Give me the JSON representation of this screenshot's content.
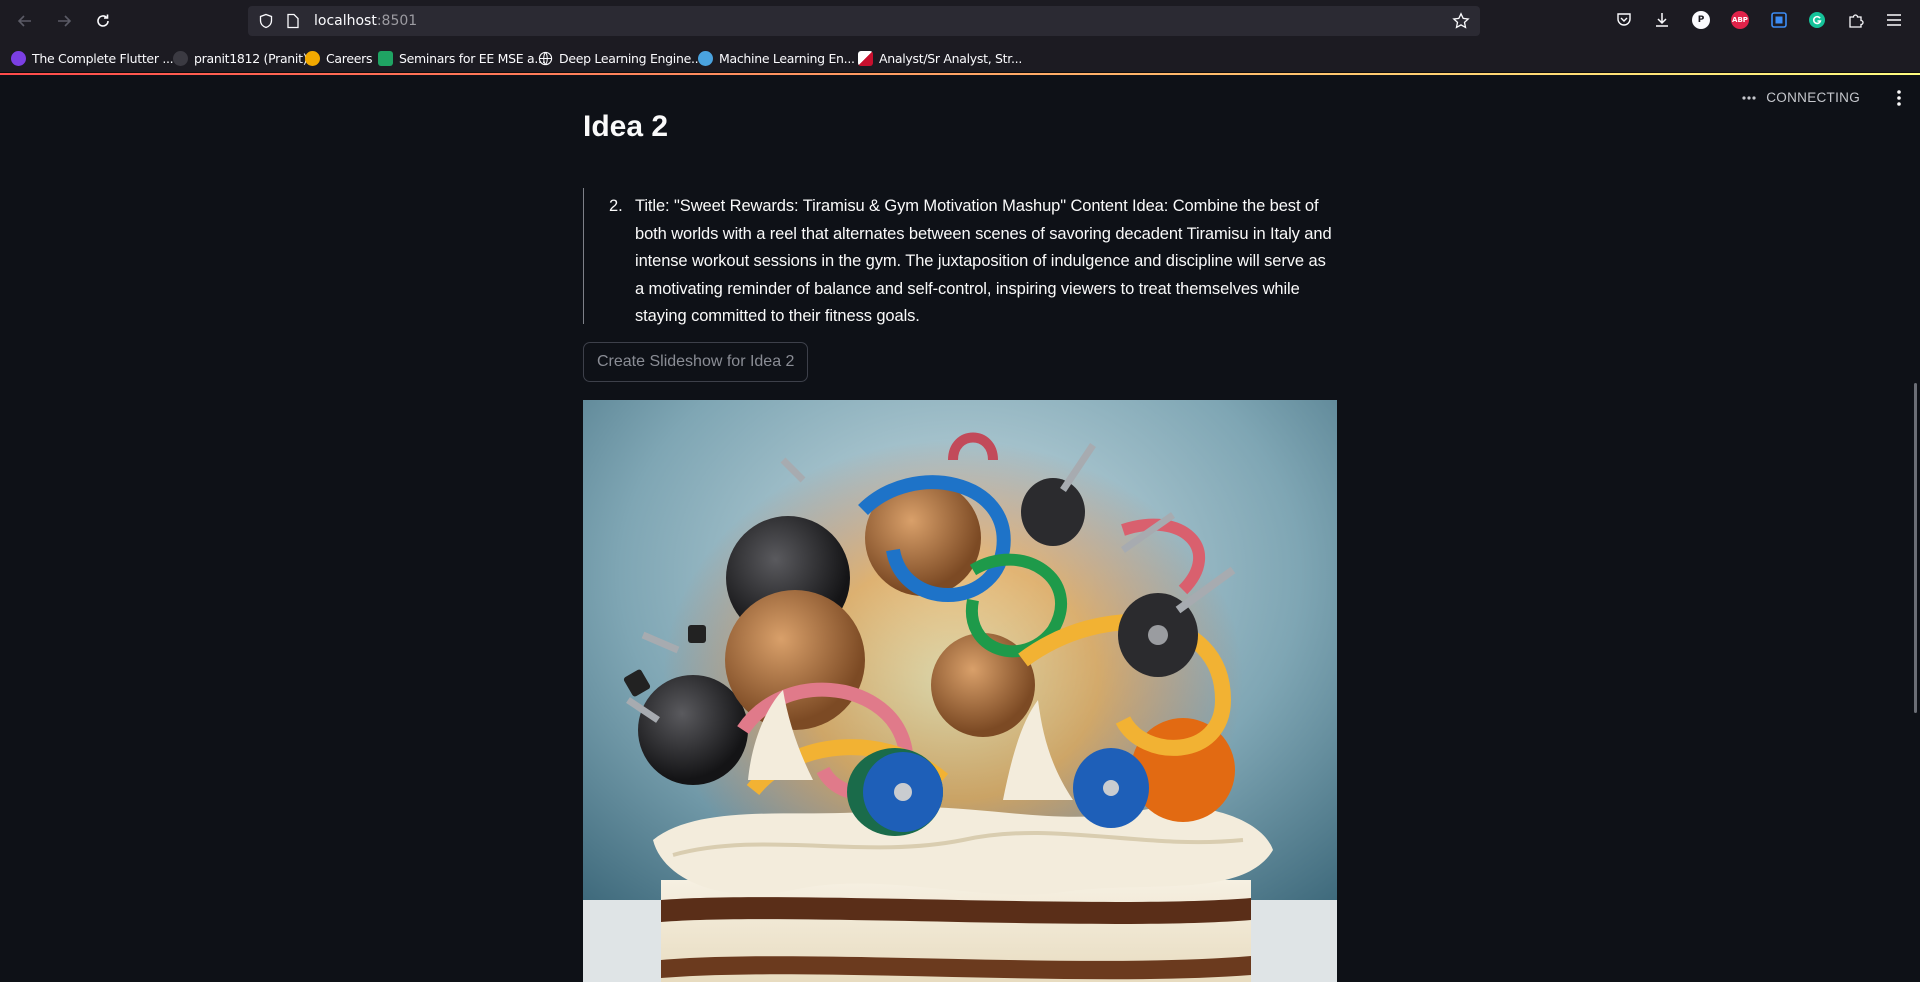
{
  "browser": {
    "url_host": "localhost",
    "url_port": ":8501",
    "bookmarks": [
      {
        "label": "The Complete Flutter ...",
        "color": "#7b3fe4"
      },
      {
        "label": "pranit1812 (Pranit)",
        "color": "#2b2a33"
      },
      {
        "label": "Careers",
        "color": "#f2a900"
      },
      {
        "label": "Seminars for EE MSE a...",
        "color": "#1fa463"
      },
      {
        "label": "Deep Learning Engine...",
        "color": "#1c1b22"
      },
      {
        "label": "Machine Learning En...",
        "color": "#4aa3df"
      },
      {
        "label": "Analyst/Sr Analyst, Str...",
        "color": "#ffffff"
      }
    ],
    "extensions": {
      "p_label": "P",
      "abp_label": "ABP"
    }
  },
  "app": {
    "status": "CONNECTING"
  },
  "idea": {
    "heading": "Idea 2",
    "number": "2.",
    "text": "Title: \"Sweet Rewards: Tiramisu & Gym Motivation Mashup\" Content Idea: Combine the best of both worlds with a reel that alternates between scenes of savoring decadent Tiramisu in Italy and intense workout sessions in the gym. The juxtaposition of indulgence and discipline will serve as a motivating reminder of balance and self-control, inspiring viewers to treat themselves while staying committed to their fitness goals.",
    "button_label": "Create Slideshow for Idea 2"
  },
  "colors": {
    "background": "#0e1117",
    "accent_start": "#ff4b4b",
    "accent_end": "#fffd80"
  }
}
